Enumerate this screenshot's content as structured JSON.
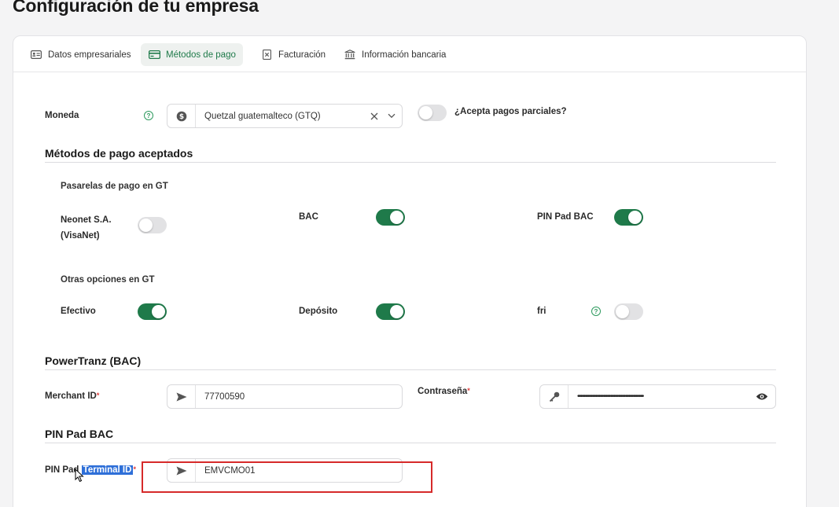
{
  "page": {
    "title": "Configuración de tu empresa"
  },
  "tabs": [
    {
      "label": "Datos empresariales",
      "icon": "id-card-icon"
    },
    {
      "label": "Métodos de pago",
      "icon": "credit-card-icon",
      "active": true
    },
    {
      "label": "Facturación",
      "icon": "invoice-icon"
    },
    {
      "label": "Información bancaria",
      "icon": "bank-icon"
    }
  ],
  "currency": {
    "label": "Moneda",
    "value": "Quetzal guatemalteco (GTQ)",
    "icon": "dollar-icon"
  },
  "partial_payments": {
    "label": "¿Acepta pagos parciales?",
    "enabled": false
  },
  "accepted_methods": {
    "title": "Métodos de pago aceptados",
    "gateways_label": "Pasarelas de pago en GT",
    "gateways": [
      {
        "label_line1": "Neonet S.A.",
        "label_line2": "(VisaNet)",
        "enabled": false
      },
      {
        "label": "BAC",
        "enabled": true
      },
      {
        "label": "PIN Pad BAC",
        "enabled": true
      }
    ],
    "others_label": "Otras opciones en GT",
    "others": [
      {
        "label": "Efectivo",
        "enabled": true
      },
      {
        "label": "Depósito",
        "enabled": true
      },
      {
        "label": "fri",
        "enabled": false
      }
    ]
  },
  "powertranz": {
    "title": "PowerTranz (BAC)",
    "merchant_label": "Merchant ID",
    "merchant_value": "77700590",
    "password_label": "Contraseña",
    "password_value": "••••••••••••••••••••••••••••••••••••••••••••"
  },
  "pinpad": {
    "title": "PIN Pad BAC",
    "terminal_label_prefix": "PIN Pad ",
    "terminal_label_selected": "Terminal ID",
    "terminal_value": "EMVCMO01"
  },
  "colors": {
    "accent": "#1f7a4a",
    "highlight": "#d62a2a"
  }
}
